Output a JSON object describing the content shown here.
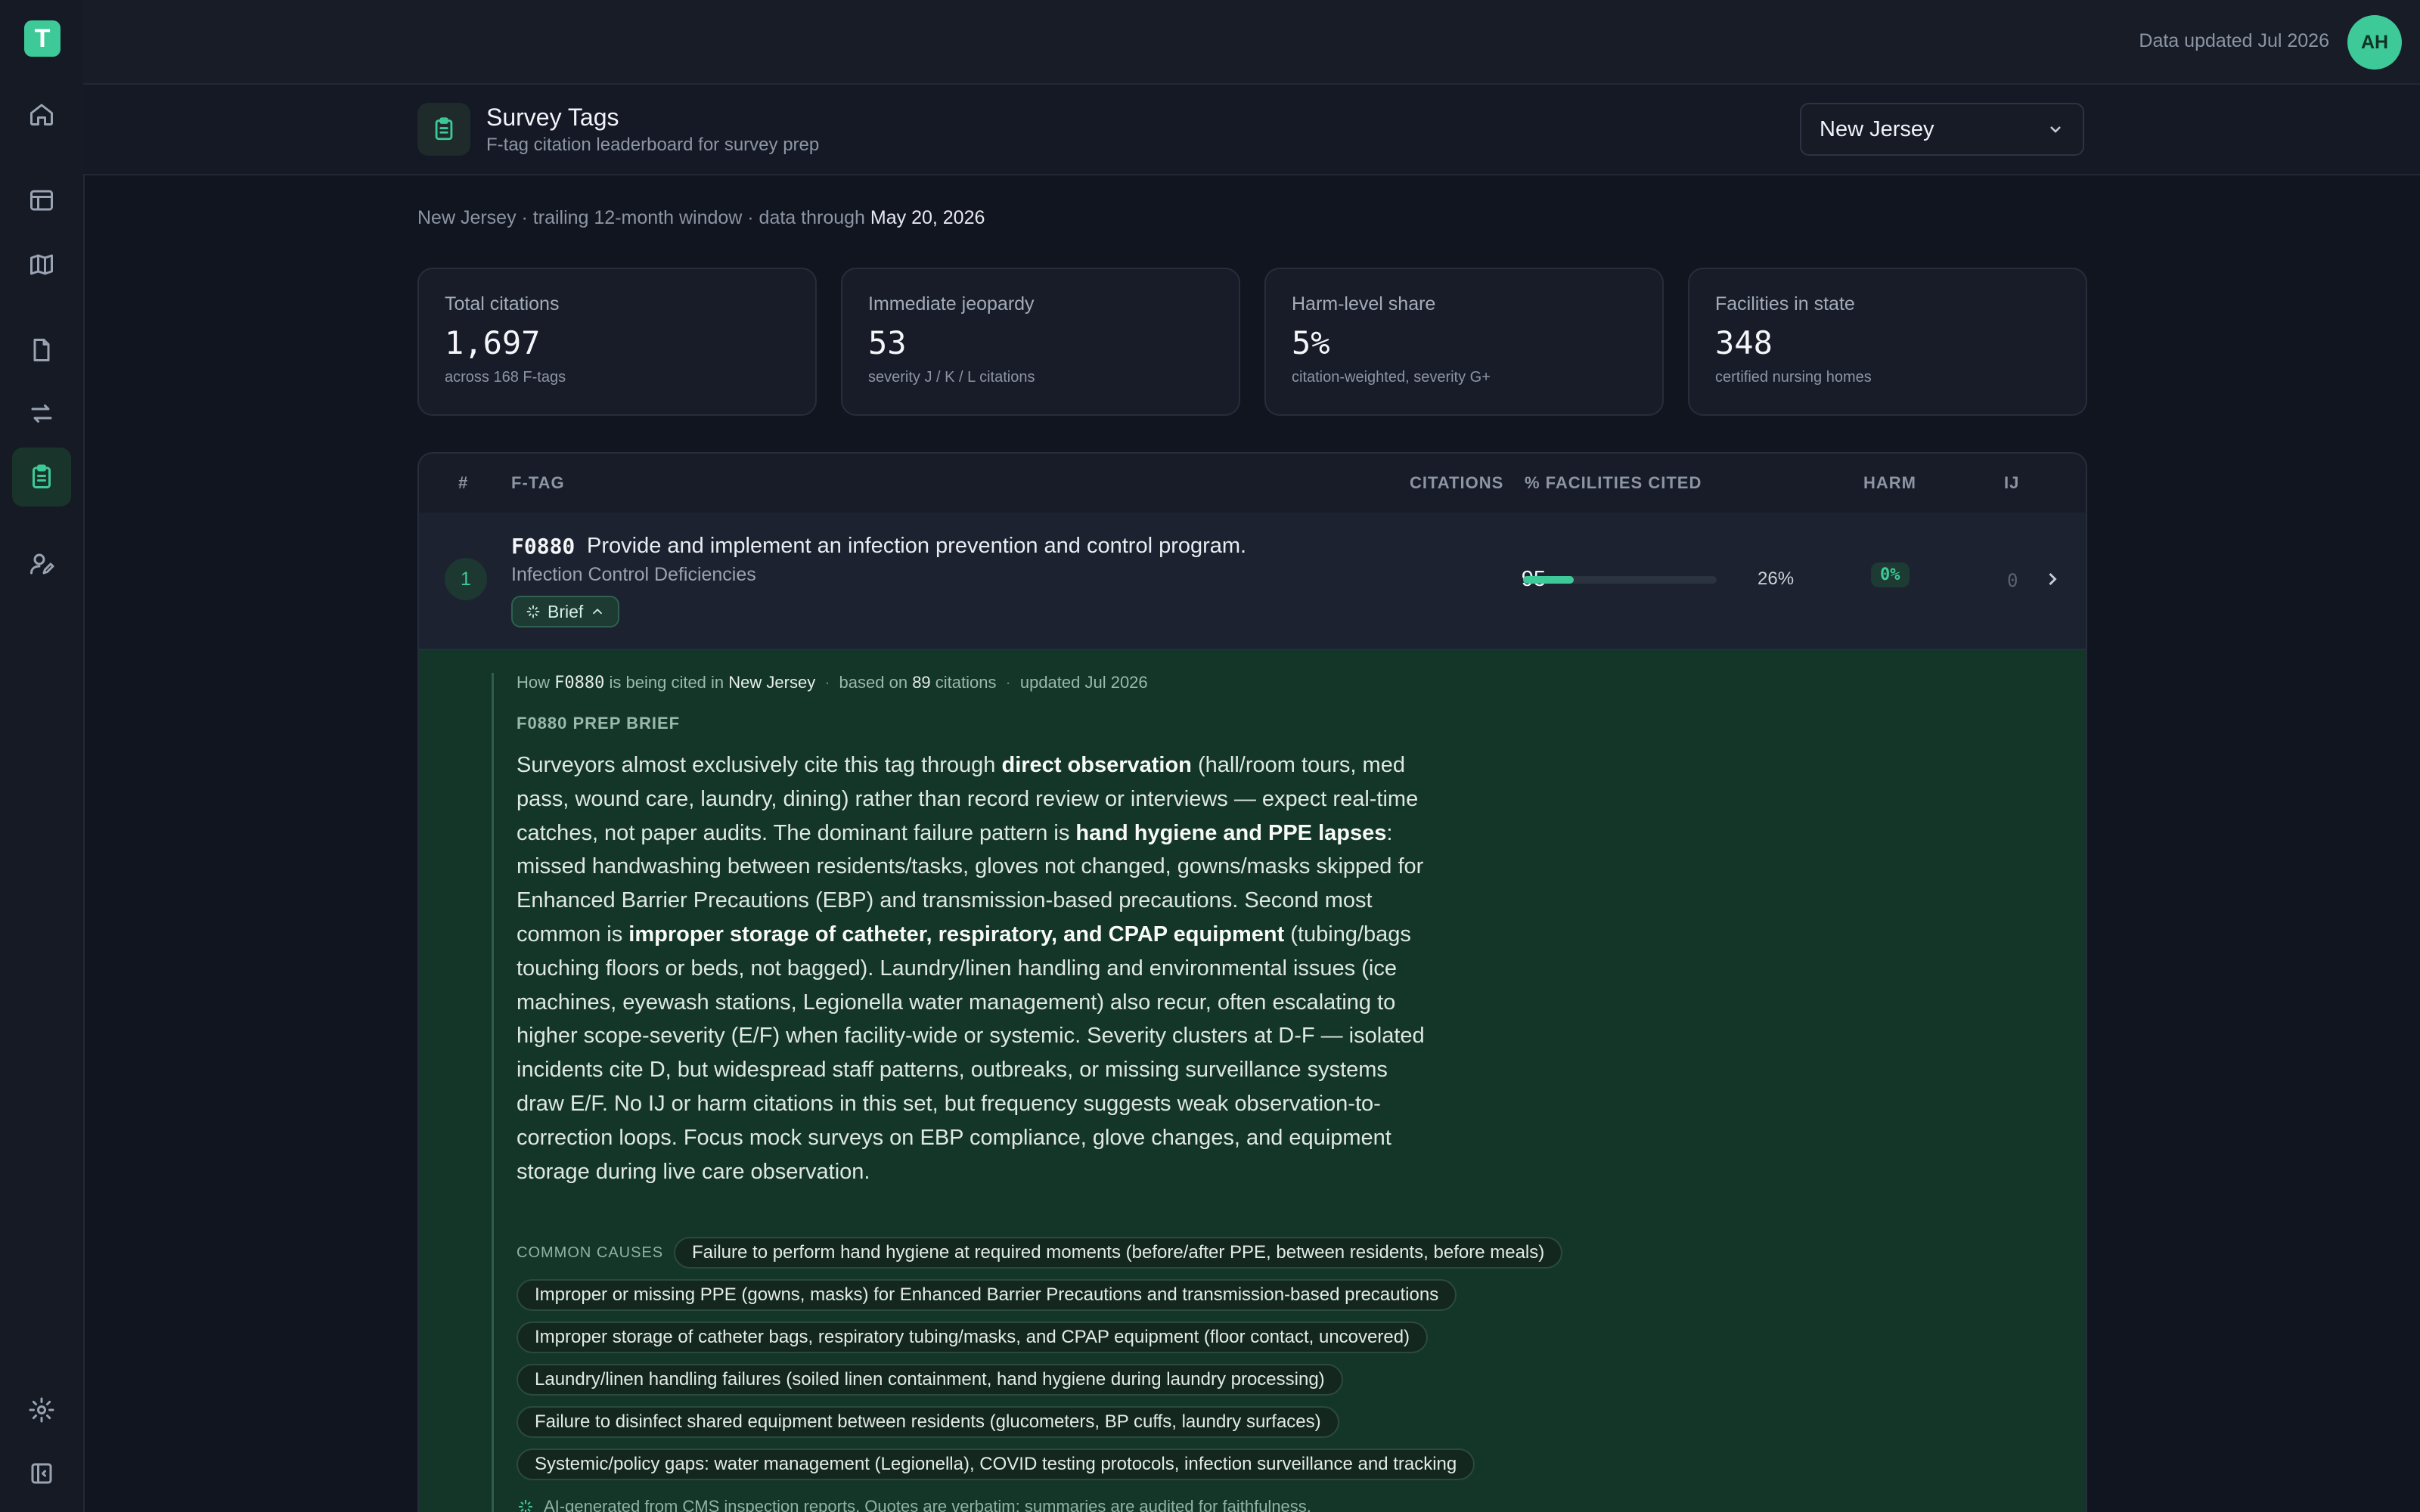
{
  "app": {
    "logo_letter": "T",
    "data_updated": "Data updated Jul 2026",
    "user_initials": "AH"
  },
  "sidebar": {
    "items": [
      {
        "icon": "home-icon",
        "active": false
      },
      {
        "icon": "table-icon",
        "active": false
      },
      {
        "icon": "map-icon",
        "active": false
      },
      {
        "icon": "document-icon",
        "active": false
      },
      {
        "icon": "transfer-icon",
        "active": false
      },
      {
        "icon": "clipboard-icon",
        "active": true
      },
      {
        "icon": "user-edit-icon",
        "active": false
      },
      {
        "icon": "settings-icon",
        "active": false
      },
      {
        "icon": "collapse-sidebar-icon",
        "active": false
      }
    ]
  },
  "header": {
    "title": "Survey Tags",
    "subtitle": "F-tag citation leaderboard for survey prep",
    "state_selected": "New Jersey"
  },
  "meta": {
    "prefix": "New Jersey · trailing 12-month window · data through ",
    "date": "May 20, 2026"
  },
  "stats": [
    {
      "label": "Total citations",
      "value": "1,697",
      "note": "across 168 F-tags"
    },
    {
      "label": "Immediate jeopardy",
      "value": "53",
      "note": "severity J / K / L citations"
    },
    {
      "label": "Harm-level share",
      "value": "5%",
      "note": "citation-weighted, severity G+"
    },
    {
      "label": "Facilities in state",
      "value": "348",
      "note": "certified nursing homes"
    }
  ],
  "table": {
    "columns": {
      "rank": "#",
      "ftag": "F-TAG",
      "citations": "CITATIONS",
      "facilities": "% FACILITIES CITED",
      "harm": "HARM",
      "ij": "IJ"
    },
    "rows": [
      {
        "rank": "1",
        "code": "F0880",
        "description": "Provide and implement an infection prevention and control program.",
        "category": "Infection Control Deficiencies",
        "brief_label": "Brief",
        "citations": "95",
        "facilities_pct": "26%",
        "facilities_fraction": 0.26,
        "harm": "0%",
        "ij": "0"
      }
    ]
  },
  "brief": {
    "meta_how": "How",
    "meta_code": "F0880",
    "meta_cited_in": "is being cited in",
    "meta_state": "New Jersey",
    "meta_based": "based on",
    "meta_count": "89",
    "meta_citations": "citations",
    "meta_updated": "updated Jul 2026",
    "title": "F0880 PREP BRIEF",
    "body": [
      {
        "t": "Surveyors almost exclusively cite this tag through ",
        "b": false
      },
      {
        "t": "direct observation",
        "b": true
      },
      {
        "t": " (hall/room tours, med pass, wound care, laundry, dining) rather than record review or interviews — expect real-time catches, not paper audits. The dominant failure pattern is ",
        "b": false
      },
      {
        "t": "hand hygiene and PPE lapses",
        "b": true
      },
      {
        "t": ": missed handwashing between residents/tasks, gloves not changed, gowns/masks skipped for Enhanced Barrier Precautions (EBP) and transmission-based precautions. Second most common is ",
        "b": false
      },
      {
        "t": "improper storage of catheter, respiratory, and CPAP equipment",
        "b": true
      },
      {
        "t": " (tubing/bags touching floors or beds, not bagged). Laundry/linen handling and environmental issues (ice machines, eyewash stations, Legionella water management) also recur, often escalating to higher scope-severity (E/F) when facility-wide or systemic. Severity clusters at D-F — isolated incidents cite D, but widespread staff patterns, outbreaks, or missing surveillance systems draw E/F. No IJ or harm citations in this set, but frequency suggests weak observation-to-correction loops. Focus mock surveys on EBP compliance, glove changes, and equipment storage during live care observation.",
        "b": false
      }
    ],
    "causes_label": "COMMON CAUSES",
    "causes": [
      "Failure to perform hand hygiene at required moments (before/after PPE, between residents, before meals)",
      "Improper or missing PPE (gowns, masks) for Enhanced Barrier Precautions and transmission-based precautions",
      "Improper storage of catheter bags, respiratory tubing/masks, and CPAP equipment (floor contact, uncovered)",
      "Laundry/linen handling failures (soiled linen containment, hand hygiene during laundry processing)",
      "Failure to disinfect shared equipment between residents (glucometers, BP cuffs, laundry surfaces)",
      "Systemic/policy gaps: water management (Legionella), COVID testing protocols, infection surveillance and tracking"
    ],
    "footnote": "AI-generated from CMS inspection reports. Quotes are verbatim; summaries are audited for faithfulness."
  },
  "colors": {
    "accent": "#3ec998",
    "background": "#111520",
    "brief_bg": "#143629"
  }
}
